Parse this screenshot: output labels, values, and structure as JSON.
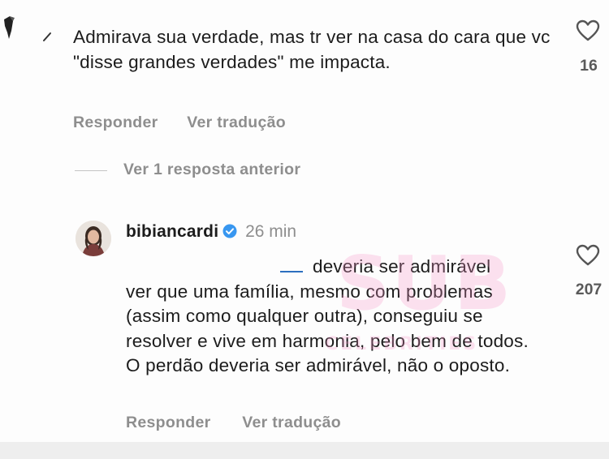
{
  "comments": [
    {
      "text": "Admirava sua verdade, mas tr ver na casa do cara que vc \"disse grandes verdades\" me impacta.",
      "likes": "16",
      "actions": {
        "reply": "Responder",
        "translate": "Ver tradução"
      }
    }
  ],
  "replies_toggle": {
    "label": "Ver 1 resposta anterior"
  },
  "reply": {
    "username": "bibiancardi",
    "verified": true,
    "time": "26 min",
    "text_first": "deveria ser admirável",
    "text_rest": "ver que uma família, mesmo com problemas (assim como qualquer outra), conseguiu se resolver e vive em harmonia, pelo bem de todos. O perdão deveria ser admirável, não o oposto.",
    "likes": "207",
    "actions": {
      "reply": "Responder",
      "translate": "Ver tradução"
    }
  },
  "watermark": {
    "big": "SUB",
    "small": "CELEBRITIES"
  },
  "colors": {
    "secondary_text": "#8e8e8e",
    "verified_blue": "#3897f0",
    "watermark_pink": "#f896c8"
  },
  "icons": [
    "heart-outline-icon",
    "verified-badge-icon"
  ]
}
